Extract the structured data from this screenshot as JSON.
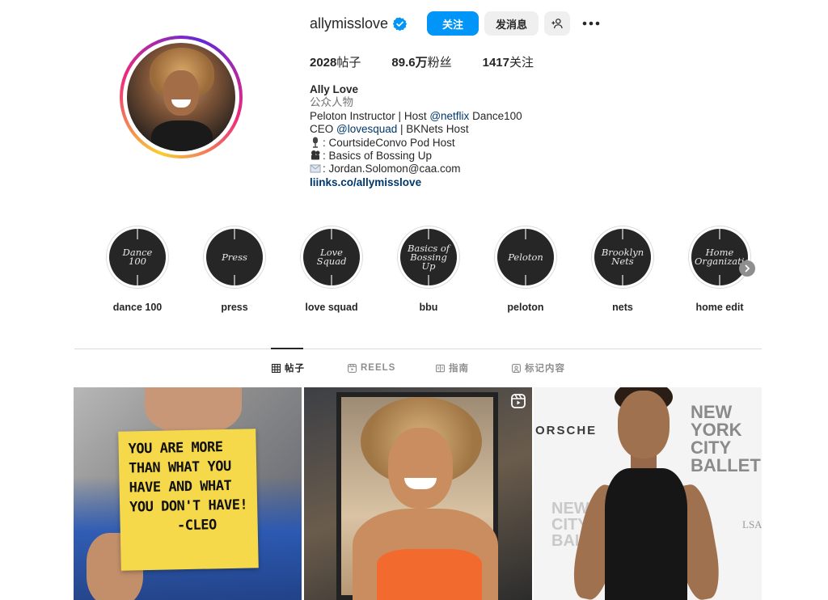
{
  "profile": {
    "username": "allymisslove",
    "follow_label": "关注",
    "message_label": "发消息",
    "stats": [
      {
        "value": "2028",
        "label": "帖子"
      },
      {
        "value": "89.6万",
        "label": "粉丝"
      },
      {
        "value": "1417",
        "label": "关注"
      }
    ],
    "bio": {
      "name": "Ally Love",
      "category": "公众人物",
      "line1_text": "Peloton Instructor | Host ",
      "line1_mention": "@netflix",
      "line1_suffix": " Dance100",
      "line2_prefix": "CEO ",
      "line2_mention": "@lovesquad",
      "line2_suffix": " | BKNets Host",
      "line3": ": CourtsideConvo Pod Host",
      "line4": ": Basics of Bossing Up",
      "line5": ": Jordan.Solomon@caa.com",
      "link": "liinks.co/allymisslove"
    }
  },
  "highlights": [
    {
      "cover_text": "Dance 100",
      "label": "dance 100"
    },
    {
      "cover_text": "Press",
      "label": "press"
    },
    {
      "cover_text": "Love Squad",
      "label": "love squad"
    },
    {
      "cover_text": "Basics of Bossing Up",
      "label": "bbu"
    },
    {
      "cover_text": "Peloton",
      "label": "peloton"
    },
    {
      "cover_text": "Brooklyn Nets",
      "label": "nets"
    },
    {
      "cover_text": "Home Organization",
      "label": "home edit"
    }
  ],
  "tabs": [
    {
      "label": "帖子",
      "icon": "grid-icon",
      "active": true
    },
    {
      "label": "REELS",
      "icon": "reels-icon",
      "active": false
    },
    {
      "label": "指南",
      "icon": "guide-icon",
      "active": false
    },
    {
      "label": "标记内容",
      "icon": "tagged-icon",
      "active": false
    }
  ],
  "posts": [
    {
      "note_text": "YOU ARE MORE\nTHAN WHAT YOU\nHAVE AND WHAT\nYOU DON'T HAVE!\n      -CLEO"
    },
    {
      "type": "reel"
    },
    {
      "backdrop_text_1": "ORSCHE",
      "backdrop_text_2": "NEW\nYORK\nCITY\nBALLET",
      "backdrop_text_3": "NEW\nCITY\nBALLE",
      "backdrop_text_4": "LSA"
    }
  ],
  "colors": {
    "accent": "#0095f6",
    "link": "#00376b",
    "muted": "#737373"
  }
}
